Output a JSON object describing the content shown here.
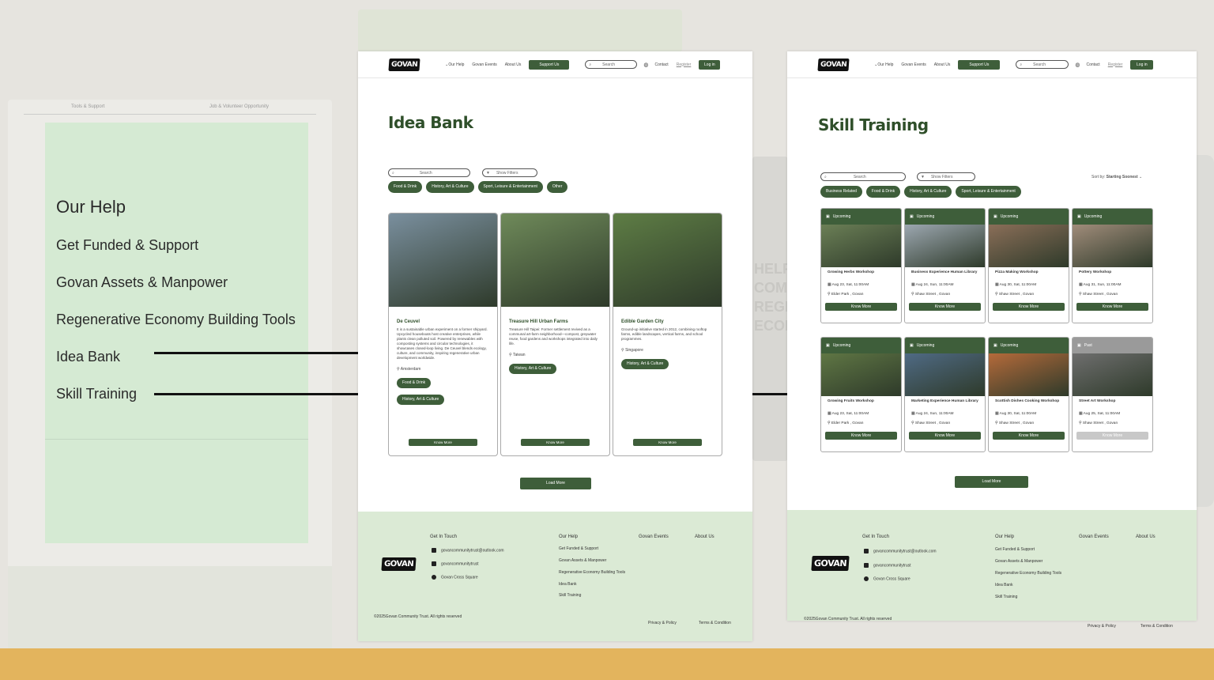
{
  "ghost": {
    "tab_left": "Tools & Support",
    "tab_right": "Job & Volunteer Opportunity",
    "mid_lines": [
      "HELP",
      "COM",
      "REGE",
      "ECOI"
    ]
  },
  "help_panel": {
    "title": "Our Help",
    "items": [
      "Get Funded & Support",
      "Govan Assets & Manpower",
      "Regenerative Economy Building Tools",
      "Idea Bank",
      "Skill Training"
    ]
  },
  "nav": {
    "logo": "GOVAN",
    "our_help": "Our Help",
    "govan_events": "Govan Events",
    "about_us": "About Us",
    "support_us": "Support Us",
    "search_placeholder": "Search",
    "contact": "Contact",
    "register": "Register",
    "login": "Log in"
  },
  "idea_bank": {
    "title": "Idea Bank",
    "search_placeholder": "Search",
    "show_filters": "Show Filters",
    "filters": [
      "Food & Drink",
      "History, Art & Culture",
      "Sport, Leisure & Entertainment",
      "Other"
    ],
    "cards": [
      {
        "title": "De Ceuvel",
        "desc": "It is a sustainable urban experiment on a former shipyard. Upcycled houseboats host creative enterprises, while plants clean polluted soil. Powered by renewables with composting systems and circular technologies, it showcases closed-loop living. De Ceuvel blends ecology, culture, and community, inspiring regenerative urban development worldwide.",
        "location": "Amsterdam",
        "tags": [
          "Food & Drink",
          "History, Art & Culture"
        ],
        "button": "Know More",
        "image_color": "#7a8f9e"
      },
      {
        "title": "Treasure Hill Urban Farms",
        "desc": "Treasure Hill Taipei: Former settlement revived as a communal art-farm neighborhood—compost, greywater reuse, food gardens and workshops integrated into daily life.",
        "location": "Taiwan",
        "tags": [
          "History, Art & Culture"
        ],
        "button": "Know More",
        "image_color": "#6f8a5a"
      },
      {
        "title": "Edible Garden City",
        "desc": "Ground-up initiative started in 2012, combining rooftop farms, edible landscapes, vertical farms, and school programmes.",
        "location": "Singapore",
        "tags": [
          "History, Art & Culture"
        ],
        "button": "Know More",
        "image_color": "#5e7d45"
      }
    ],
    "load_more": "Load More"
  },
  "skill_training": {
    "title": "Skill Training",
    "search_placeholder": "Search",
    "show_filters": "Show Filters",
    "sort_label": "Sort by:",
    "sort_value": "Starting Soonest",
    "filters": [
      "Business Related",
      "Food & Drink",
      "History, Art & Culture",
      "Sport, Leisure & Entertainment"
    ],
    "cards": [
      {
        "status": "Upcoming",
        "title": "Growing Herbs Workshop",
        "date": "Aug 23, Sat, 11:00AM",
        "place": "Elder Park , Govan",
        "button": "Know More",
        "image_color": "#6b7f56"
      },
      {
        "status": "Upcoming",
        "title": "Business Experience Human Library",
        "date": "Aug 24, Sun, 11:00AM",
        "place": "Shaw Street , Govan",
        "button": "Know More",
        "image_color": "#9ca7b0"
      },
      {
        "status": "Upcoming",
        "title": "Pizza Making Workshop",
        "date": "Aug 30, Sat, 11:00AM",
        "place": "Shaw Street , Govan",
        "button": "Know More",
        "image_color": "#8a6e58"
      },
      {
        "status": "Upcoming",
        "title": "Pottery Workshop",
        "date": "Aug 31, Sun, 11:00AM",
        "place": "Shaw Street , Govan",
        "button": "Know More",
        "image_color": "#a08c7a"
      },
      {
        "status": "Upcoming",
        "title": "Growing Fruits Workshop",
        "date": "Aug 23, Sat, 11:00AM",
        "place": "Elder Park , Govan",
        "button": "Know More",
        "image_color": "#5f7644"
      },
      {
        "status": "Upcoming",
        "title": "Marketing Experience Human Library",
        "date": "Aug 24, Sun, 11:00AM",
        "place": "Shaw Street , Govan",
        "button": "Know More",
        "image_color": "#4f6a84"
      },
      {
        "status": "Upcoming",
        "title": "Scottish Dishes Cooking Workshop",
        "date": "Aug 30, Sat, 11:00AM",
        "place": "Shaw Street , Govan",
        "button": "Know More",
        "image_color": "#b46a3a"
      },
      {
        "status": "Past",
        "title": "Street Art Workshop",
        "date": "Aug 25, Sat, 11:00AM",
        "place": "Shaw Street , Govan",
        "button": "Know More",
        "image_color": "#6e6e6e"
      }
    ],
    "load_more": "Load More"
  },
  "footer": {
    "get_in_touch": "Get In Touch",
    "email": "govancommunitytrust@outlook.com",
    "instagram": "govancommunitytrust",
    "address": "Govan Cross Square",
    "our_help": "Our Help",
    "help_links": [
      "Get Funded & Support",
      "Govan Assets & Manpower",
      "Regenerative Economy Building Tools",
      "Idea Bank",
      "Skill Training"
    ],
    "govan_events": "Govan Events",
    "about_us": "About Us",
    "copyright": "©2025Govan Community Trust. All rights reserved",
    "privacy": "Privacy & Policy",
    "terms": "Terms & Condition"
  },
  "colors": {
    "accent": "#3e5e3a",
    "panel": "#d5ead3",
    "footer": "#dbead5",
    "band": "#e3b45d"
  }
}
